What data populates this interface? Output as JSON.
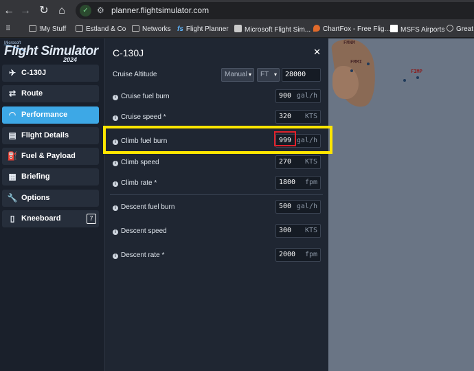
{
  "browser": {
    "url": "planner.flightsimulator.com",
    "bookmarks": [
      {
        "label": "!My Stuff",
        "icon": "folder-icon"
      },
      {
        "label": "Estland & Co",
        "icon": "folder-icon"
      },
      {
        "label": "Networks",
        "icon": "folder-icon"
      },
      {
        "label": "Flight Planner",
        "icon": "fs-icon"
      },
      {
        "label": "Microsoft Flight Sim...",
        "icon": "page-icon"
      },
      {
        "label": "ChartFox - Free Flig...",
        "icon": "chartfox-icon"
      },
      {
        "label": "MSFS Airports",
        "icon": "msfs-icon"
      },
      {
        "label": "Great",
        "icon": "globe-icon"
      }
    ]
  },
  "logo": {
    "ms": "Microsoft",
    "main": "Flight Simulator",
    "year": "2024"
  },
  "sidebar": {
    "items": [
      {
        "label": "C-130J",
        "icon": "airplane-icon",
        "active": false
      },
      {
        "label": "Route",
        "icon": "route-icon",
        "active": false
      },
      {
        "label": "Performance",
        "icon": "gauge-icon",
        "active": true
      },
      {
        "label": "Flight Details",
        "icon": "clipboard-icon",
        "active": false
      },
      {
        "label": "Fuel & Payload",
        "icon": "fuel-icon",
        "active": false
      },
      {
        "label": "Briefing",
        "icon": "document-icon",
        "active": false
      },
      {
        "label": "Options",
        "icon": "wrench-icon",
        "active": false
      },
      {
        "label": "Kneeboard",
        "icon": "kneeboard-icon",
        "active": false,
        "badge": "7"
      }
    ]
  },
  "panel": {
    "title": "C-130J",
    "close": "✕",
    "cruise_altitude": {
      "label": "Cruise Altitude",
      "mode": "Manual",
      "unit": "FT",
      "value": "28000"
    },
    "rows": [
      {
        "label": "Cruise fuel burn",
        "value": "900",
        "unit": "gal/h"
      },
      {
        "label": "Cruise speed *",
        "value": "320",
        "unit": "KTS"
      },
      {
        "label": "Climb fuel burn",
        "value": "999",
        "unit": "gal/h"
      },
      {
        "label": "Climb speed",
        "value": "270",
        "unit": "KTS"
      },
      {
        "label": "Climb rate *",
        "value": "1800",
        "unit": "fpm"
      },
      {
        "label": "Descent fuel burn",
        "value": "500",
        "unit": "gal/h"
      },
      {
        "label": "Descent speed",
        "value": "300",
        "unit": "KTS"
      },
      {
        "label": "Descent rate *",
        "value": "2000",
        "unit": "fpm"
      }
    ]
  },
  "map": {
    "airports": [
      "FMNM",
      "FMMI",
      "FIMP"
    ]
  },
  "colors": {
    "accent": "#3da8e6",
    "highlight": "#ffe600",
    "focus": "#e0212b"
  }
}
